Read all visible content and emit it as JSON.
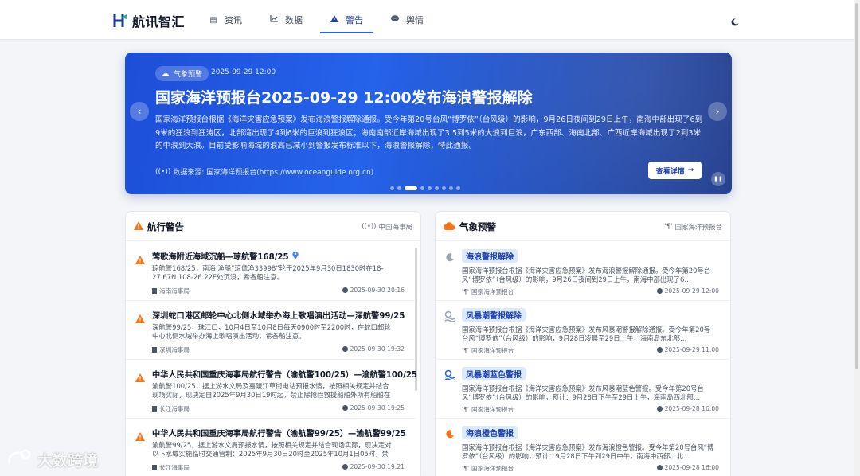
{
  "app": {
    "name": "航讯智汇"
  },
  "nav": {
    "items": [
      {
        "label": "资讯",
        "icon": "newspaper-icon"
      },
      {
        "label": "数据",
        "icon": "chart-icon"
      },
      {
        "label": "警告",
        "icon": "warning-icon"
      },
      {
        "label": "舆情",
        "icon": "comment-icon"
      }
    ],
    "active": "警告",
    "theme_icon": "moon-icon"
  },
  "hero": {
    "tag": "气象预警",
    "time": "2025-09-29 12:00",
    "title": "国家海洋预报台2025-09-29 12:00发布海浪警报解除",
    "body": "国家海洋预报台根据《海洋灾害应急预案》发布海浪警报解除通报。受今年第20号台风“博罗依”（台风级）的影响，9月26日夜间到29日上午，南海中部出现了6到9米的狂浪到狂涛区，北部湾出现了4到6米的巨浪到狂浪区；海南南部近岸海域出现了3.5到5米的大浪到巨浪，广东西部、海南北部、广西近岸海域出现了2到3米的中浪到大浪。目前受影响海域的浪高已减小到警报发布标准以下，海浪警报解除，特此通报。",
    "source": "数据来源: 国家海洋预报台(https://www.oceanguide.org.cn)",
    "button": "查看详情",
    "slide_count": 9,
    "active_slide": 3
  },
  "nav_warnings": {
    "title": "航行警告",
    "source": "中国海事局",
    "items": [
      {
        "title": "莺歌海附近海域沉船—琼航警168/25",
        "has_pin": true,
        "desc": "琼航警168/25，南海 渔船“琼儋渔33998”轮于2025年9月30日1830时在18-27.67N 108-26.22E处沉没，希各船注意。",
        "agency": "海南海事局",
        "time": "2025-09-30 20:16"
      },
      {
        "title": "深圳蛇口港区邮轮中心北侧水域举办海上歌唱演出活动—深航警99/25",
        "has_pin": false,
        "desc": "深航警99/25，珠江口，10月4日至10月8日每天0900时至2200时，在蛇口邮轮中心北侧水域举办海上歌唱演出活动，希各船注意。",
        "agency": "深圳海事局",
        "time": "2025-09-30 19:32"
      },
      {
        "title": "中华人民共和国重庆海事局航行警告（渝航警100/25）—渝航警100/25",
        "has_pin": false,
        "desc": "渝航警100/25，据上游水文局及嘉陵江草街电站预报水情，按照相关规定并结合现场实际，现决定自2025年9月30日19时起，禁止除抢险救援船舶外所有船舶在嘉…",
        "agency": "长江海事局",
        "time": "2025-09-30 19:25"
      },
      {
        "title": "中华人民共和国重庆海事局航行警告（渝航警99/25）—渝航警99/25",
        "has_pin": false,
        "desc": "渝航警99/25，据上游水文局预报水情，按照相关规定并结合现场实际，现决定对以下水域实施临时交通管制：2025年9月30日20时至2025年10月1日05时，禁止…",
        "agency": "长江海事局",
        "time": "2025-09-30 19:21"
      }
    ]
  },
  "weather": {
    "title": "气象预警",
    "source": "国家海洋预报台",
    "items": [
      {
        "badge": "海浪警报解除",
        "icon": "wave-icon",
        "icon_color": "#9ca3af",
        "desc": "国家海洋预报台根据《海洋灾害应急预案》发布海浪警报解除通报。受今年第20号台风“博罗依”（台风级）的影响，9月26日夜间到29日上午，南海中部出现了6…",
        "agency": "国家海洋预报台",
        "time": "2025-09-29 12:00"
      },
      {
        "badge": "风暴潮警报解除",
        "icon": "storm-surge-icon",
        "icon_color": "#9ca3af",
        "desc": "国家海洋预报台根据《海洋灾害应急预案》发布风暴潮警报解除通报。受今年第20号台风“博罗依”（台风级）的影响，9月28日凌晨至29日上午，海南岛东北部…",
        "agency": "国家海洋预报台",
        "time": "2025-09-29 11:00"
      },
      {
        "badge": "风暴潮蓝色警报",
        "icon": "storm-surge-icon",
        "icon_color": "#2563eb",
        "desc": "国家海洋预报台根据《海洋灾害应急预案》发布风暴潮蓝色警报。受今年第20号台风“博罗依”（台风级）的影响，预计：9月28日下午至29日上午，海南岛西北部…",
        "agency": "国家海洋预报台",
        "time": "2025-09-28 16:00"
      },
      {
        "badge": "海浪橙色警报",
        "icon": "wave-icon",
        "icon_color": "#f97316",
        "desc": "国家海洋预报台根据《海洋灾害应急预案》发布海浪橙色警报。受今年第20号台风“博罗依”（台风级）的影响，预计：9月28日下午到29日中午，南海中西部、北…",
        "agency": "国家海洋预报台",
        "time": "2025-09-28 16:00"
      }
    ]
  },
  "watermark": "大数跨境",
  "colors": {
    "primary": "#2563eb",
    "warning": "#f97316",
    "badge_bg": "#dbeafe"
  }
}
